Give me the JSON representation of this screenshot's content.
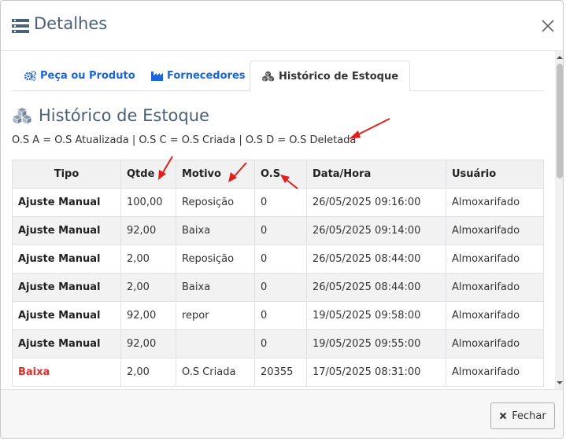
{
  "header": {
    "title": "Detalhes"
  },
  "tabs": [
    {
      "label": "Peça ou Produto",
      "icon": "gears-icon"
    },
    {
      "label": "Fornecedores",
      "icon": "industry-icon"
    },
    {
      "label": "Histórico de Estoque",
      "icon": "cubes-icon",
      "active": true
    }
  ],
  "section": {
    "title": "Histórico de Estoque",
    "legend": "O.S A = O.S Atualizada | O.S C = O.S Criada | O.S D = O.S Deletada"
  },
  "table": {
    "columns": [
      "Tipo",
      "Qtde",
      "Motivo",
      "O.S",
      "Data/Hora",
      "Usuário"
    ],
    "rows": [
      {
        "tipo": "Ajuste Manual",
        "qtde": "100,00",
        "motivo": "Reposição",
        "os": "0",
        "data": "26/05/2025 09:16:00",
        "usuario": "Almoxarifado"
      },
      {
        "tipo": "Ajuste Manual",
        "qtde": "92,00",
        "motivo": "Baixa",
        "os": "0",
        "data": "26/05/2025 09:14:00",
        "usuario": "Almoxarifado"
      },
      {
        "tipo": "Ajuste Manual",
        "qtde": "2,00",
        "motivo": "Reposição",
        "os": "0",
        "data": "26/05/2025 08:44:00",
        "usuario": "Almoxarifado"
      },
      {
        "tipo": "Ajuste Manual",
        "qtde": "2,00",
        "motivo": "Baixa",
        "os": "0",
        "data": "26/05/2025 08:44:00",
        "usuario": "Almoxarifado"
      },
      {
        "tipo": "Ajuste Manual",
        "qtde": "92,00",
        "motivo": "repor",
        "os": "0",
        "data": "19/05/2025 09:58:00",
        "usuario": "Almoxarifado"
      },
      {
        "tipo": "Ajuste Manual",
        "qtde": "92,00",
        "motivo": "",
        "os": "0",
        "data": "19/05/2025 09:55:00",
        "usuario": "Almoxarifado"
      },
      {
        "tipo": "Baixa",
        "qtde": "2,00",
        "motivo": "O.S Criada",
        "os": "20355",
        "data": "17/05/2025 08:31:00",
        "usuario": "Almoxarifado",
        "highlight": true
      }
    ]
  },
  "footer": {
    "close_label": "Fechar"
  },
  "colors": {
    "link": "#1a66d9",
    "title": "#4a6178",
    "annotation": "#e0201b",
    "danger": "#d9302e"
  }
}
